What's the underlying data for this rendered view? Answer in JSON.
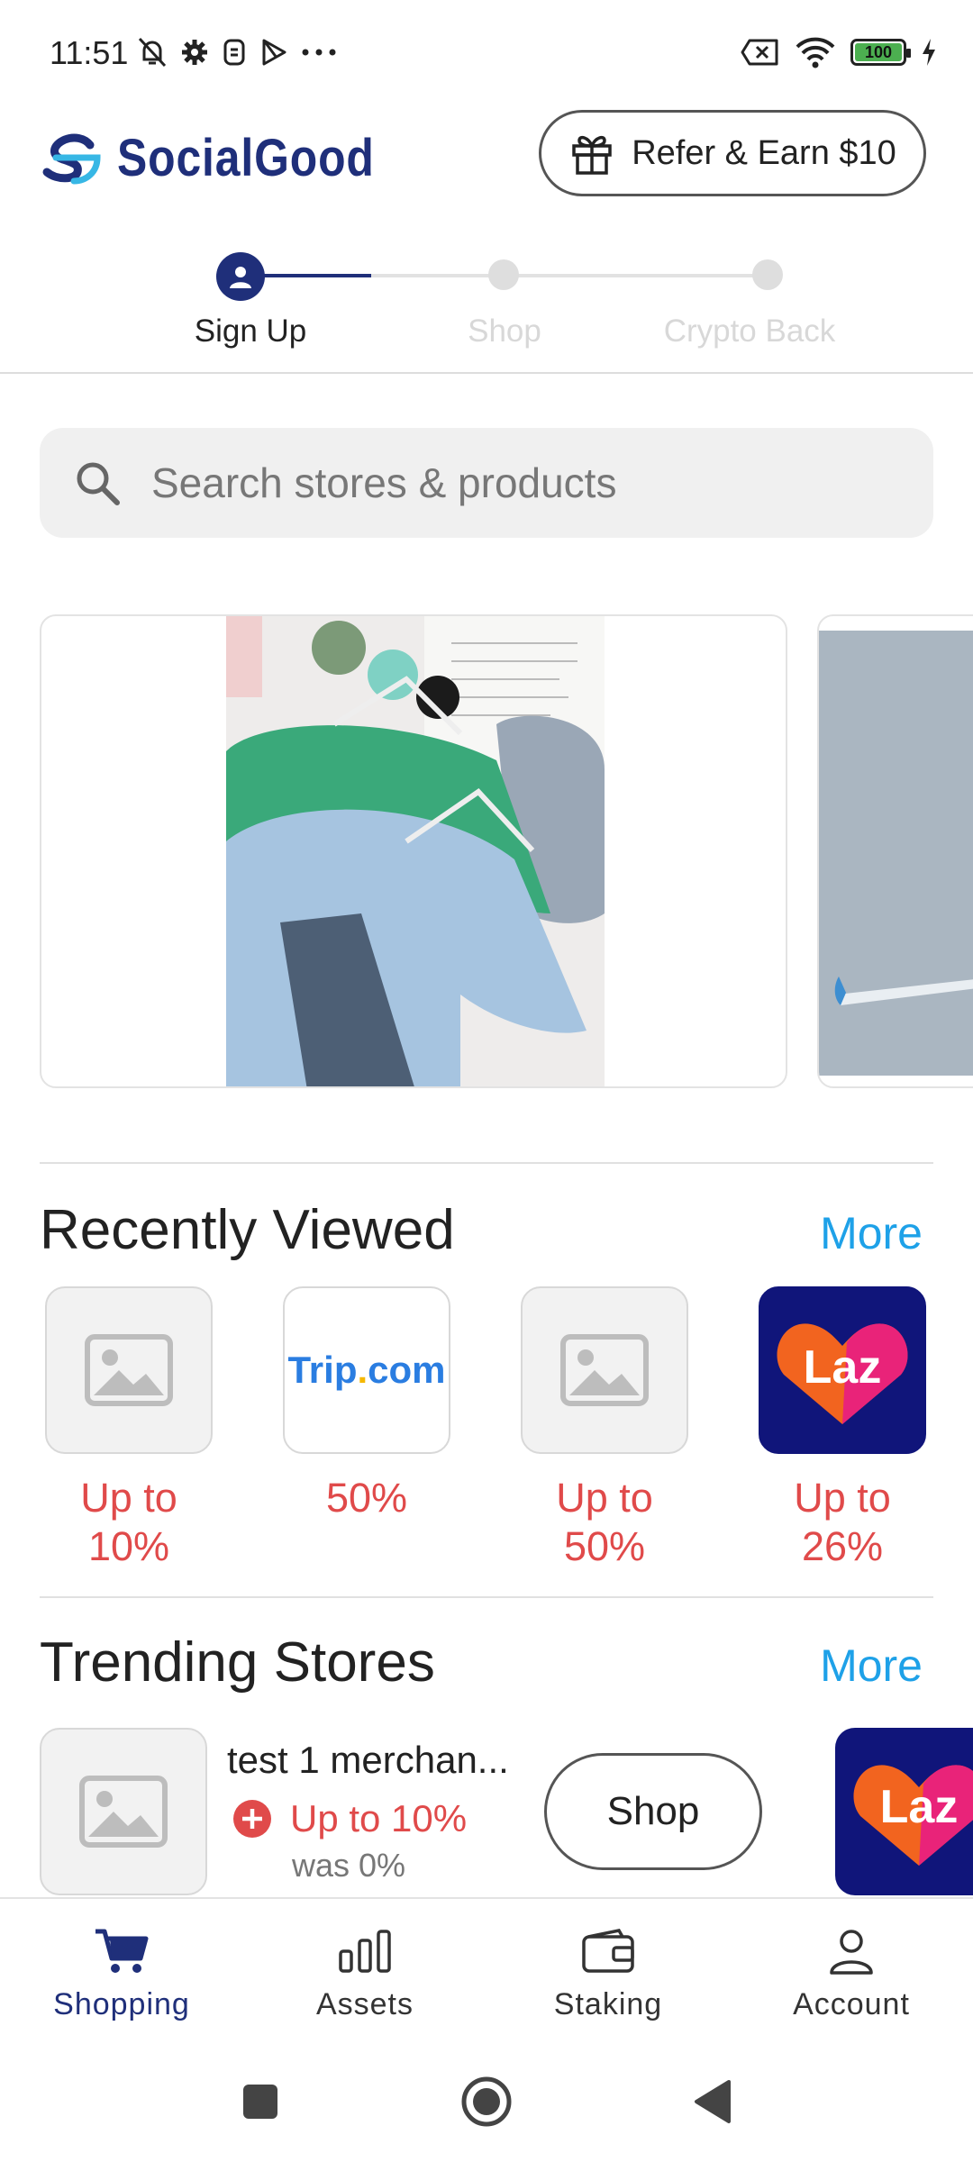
{
  "status_bar": {
    "time": "11:51",
    "battery_level": "100"
  },
  "header": {
    "brand": "SocialGood",
    "refer_label": "Refer & Earn $10"
  },
  "stepper": {
    "steps": [
      {
        "label": "Sign Up",
        "active": true
      },
      {
        "label": "Shop",
        "active": false
      },
      {
        "label": "Crypto Back",
        "active": false
      }
    ]
  },
  "search": {
    "placeholder": "Search stores & products"
  },
  "recently_viewed": {
    "title": "Recently Viewed",
    "more_label": "More",
    "items": [
      {
        "logo": "placeholder-image",
        "rate_line1": "Up to",
        "rate_line2": "10%"
      },
      {
        "logo": "Trip.com",
        "rate_line1": "50%",
        "rate_line2": ""
      },
      {
        "logo": "placeholder-image",
        "rate_line1": "Up to",
        "rate_line2": "50%"
      },
      {
        "logo": "Laz",
        "rate_line1": "Up to",
        "rate_line2": "26%"
      }
    ]
  },
  "trending_stores": {
    "title": "Trending Stores",
    "more_label": "More",
    "item": {
      "name": "test 1 merchan...",
      "rate": "Up to 10%",
      "was": "was 0%",
      "shop_label": "Shop"
    },
    "next_logo": "Laz"
  },
  "bottom_nav": {
    "items": [
      {
        "label": "Shopping",
        "icon": "cart-icon",
        "active": true
      },
      {
        "label": "Assets",
        "icon": "bar-chart-icon",
        "active": false
      },
      {
        "label": "Staking",
        "icon": "wallet-icon",
        "active": false
      },
      {
        "label": "Account",
        "icon": "person-icon",
        "active": false
      }
    ]
  },
  "colors": {
    "brand": "#1f2f7a",
    "accent_link": "#1ea1e8",
    "rate_red": "#e04a4a",
    "lazada_bg": "#10157a"
  }
}
